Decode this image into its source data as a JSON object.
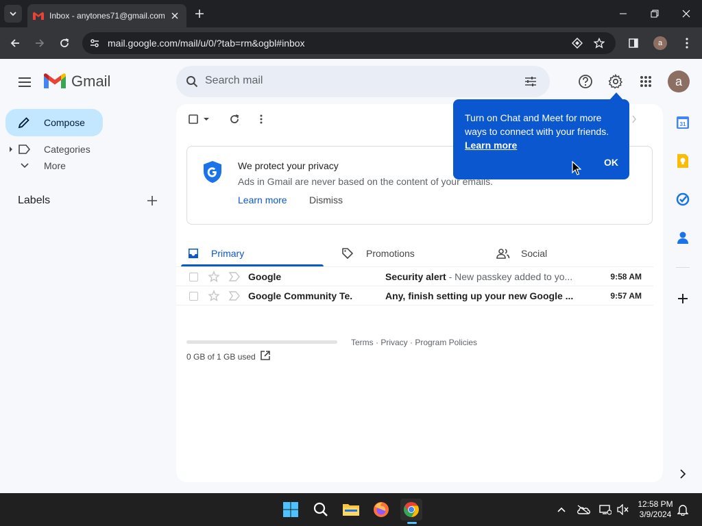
{
  "browser": {
    "tab_title": "Inbox - anytones71@gmail.com",
    "url": "mail.google.com/mail/u/0/?tab=rm&ogbl#inbox",
    "profile_initial": "a"
  },
  "gmail": {
    "logo_text": "Gmail",
    "search_placeholder": "Search mail",
    "avatar_initial": "a"
  },
  "sidebar": {
    "compose_label": "Compose",
    "items": [
      {
        "label": "Categories",
        "icon": "label-icon"
      },
      {
        "label": "More",
        "icon": "chevron-down-icon"
      }
    ],
    "labels_title": "Labels"
  },
  "privacy_card": {
    "title": "We protect your privacy",
    "description": "Ads in Gmail are never based on the content of your emails.",
    "learn_more": "Learn more",
    "dismiss": "Dismiss"
  },
  "category_tabs": [
    {
      "label": "Primary",
      "active": true
    },
    {
      "label": "Promotions",
      "active": false
    },
    {
      "label": "Social",
      "active": false
    }
  ],
  "emails": [
    {
      "sender": "Google",
      "subject": "Security alert",
      "snippet": " - New passkey added to yo...",
      "time": "9:58 AM"
    },
    {
      "sender": "Google Community Te.",
      "subject": "Any, finish setting up your new Google ...",
      "snippet": "",
      "time": "9:57 AM"
    }
  ],
  "footer": {
    "storage": "0 GB of 1 GB used",
    "links": "Terms · Privacy · Program Policies"
  },
  "tooltip": {
    "text": "Turn on Chat and Meet for more ways to connect with your friends.",
    "learn_more": "Learn more",
    "ok": "OK"
  },
  "taskbar": {
    "time": "12:58 PM",
    "date": "3/9/2024"
  },
  "colors": {
    "accent": "#0b57d0",
    "compose_bg": "#c2e7ff",
    "gmail_red": "#ea4335",
    "gmail_blue": "#4285f4",
    "gmail_green": "#34a853",
    "gmail_yellow": "#fbbc04"
  }
}
